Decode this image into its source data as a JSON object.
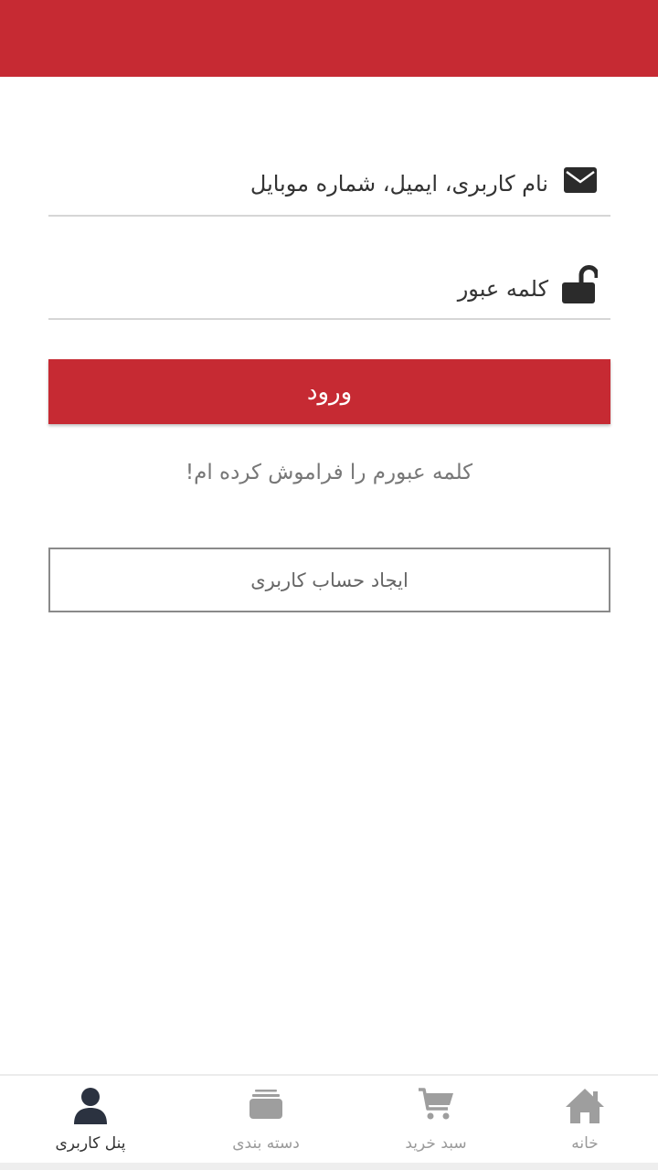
{
  "header": {
    "color": "#c62a33"
  },
  "login_form": {
    "username_placeholder": "نام کاربری، ایمیل، شماره موبایل",
    "username_icon": "envelope-icon",
    "password_placeholder": "کلمه عبور",
    "password_icon": "unlock-icon",
    "login_label": "ورود",
    "forgot_password_label": "کلمه عبورم را فراموش کرده ام!",
    "create_account_label": "ایجاد حساب کاربری"
  },
  "bottom_nav": {
    "items": [
      {
        "label": "خانه",
        "icon": "home-icon",
        "active": false
      },
      {
        "label": "سبد خرید",
        "icon": "cart-icon",
        "active": false
      },
      {
        "label": "دسته بندی",
        "icon": "layers-icon",
        "active": false
      },
      {
        "label": "پنل کاربری",
        "icon": "user-icon",
        "active": true
      }
    ]
  }
}
